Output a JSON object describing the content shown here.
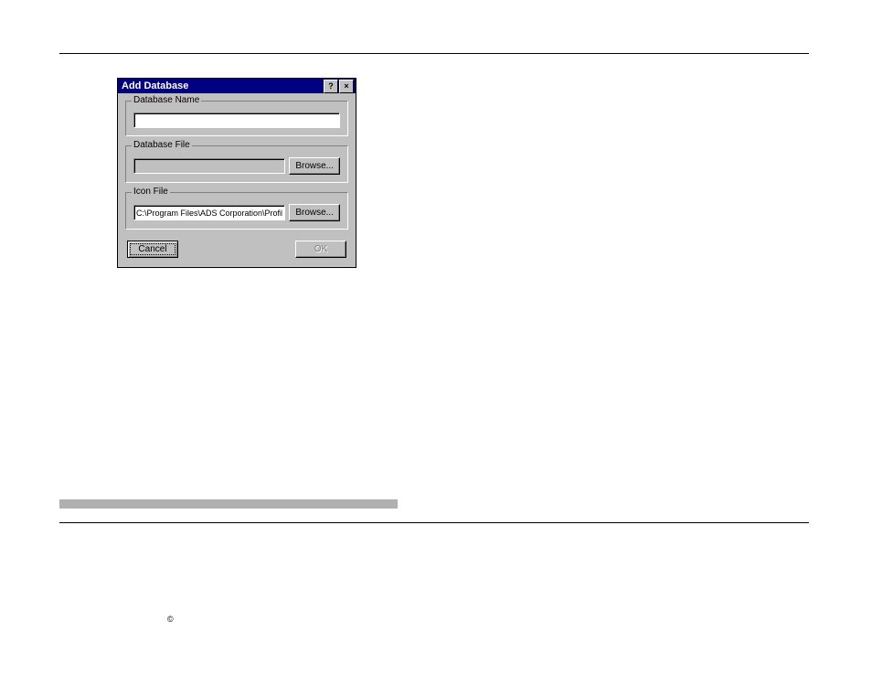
{
  "dialog": {
    "title": "Add Database",
    "help_icon": "?",
    "close_icon": "×",
    "database_name": {
      "legend": "Database Name",
      "value": ""
    },
    "database_file": {
      "legend": "Database File",
      "value": "",
      "browse": "Browse..."
    },
    "icon_file": {
      "legend": "Icon File",
      "value": "C:\\Program Files\\ADS Corporation\\Profile\\resdll.dll",
      "browse": "Browse..."
    },
    "cancel": "Cancel",
    "ok": "OK"
  },
  "copyright": "©"
}
